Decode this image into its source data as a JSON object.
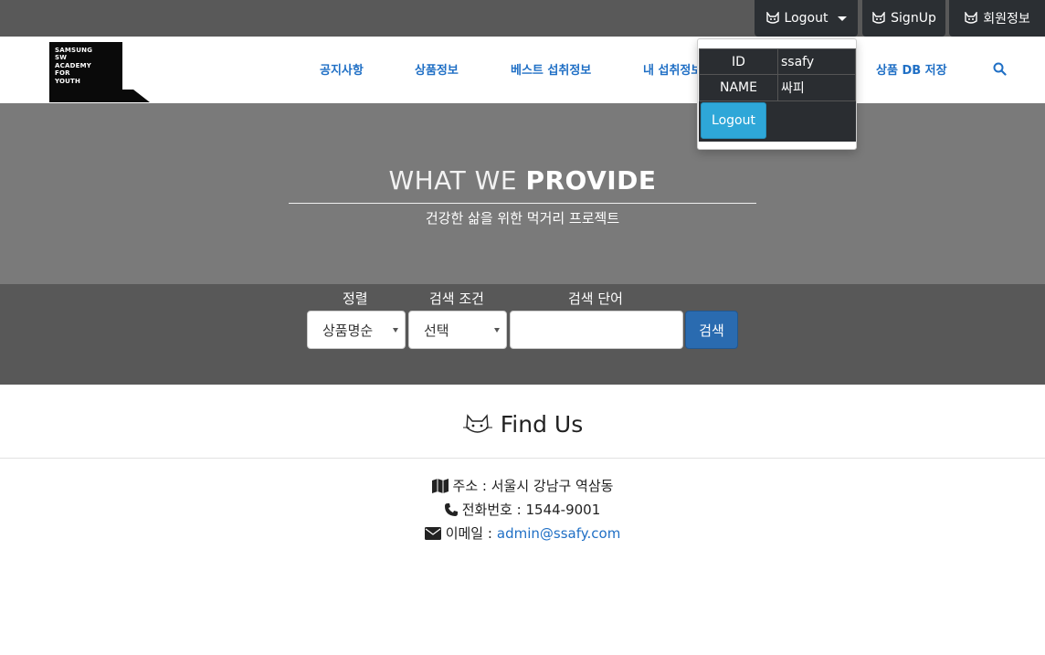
{
  "topbar": {
    "logout_label": "Logout",
    "signup_label": "SignUp",
    "member_label": "회원정보",
    "icon": "cat-icon"
  },
  "logo": {
    "lines": [
      "SAMSUNG",
      "SW",
      "ACADEMY",
      "FOR",
      "YOUTH"
    ]
  },
  "nav": {
    "items": [
      "공지사항",
      "상품정보",
      "베스트 섭취정보",
      "내 섭취정보",
      "상품 DB 저장"
    ],
    "search_icon": "search-icon"
  },
  "user_dropdown": {
    "id_label": "ID",
    "id_value": "ssafy",
    "name_label": "NAME",
    "name_value": "싸피",
    "logout_button": "Logout"
  },
  "hero": {
    "title_prefix": "WHAT WE",
    "title_bold": "PROVIDE",
    "subtitle": "건강한 삶을 위한 먹거리 프로젝트"
  },
  "search": {
    "sort_label": "정렬",
    "condition_label": "검색 조건",
    "keyword_label": "검색 단어",
    "sort_value": "상품명순",
    "condition_value": "선택",
    "keyword_value": "",
    "button_label": "검색"
  },
  "find_us": {
    "title": "Find Us",
    "address": "주소 : 서울시 강남구 역삼동",
    "phone": "전화번호 : 1544-9001",
    "email_label": "이메일 :",
    "email": "admin@ssafy.com"
  },
  "colors": {
    "topbar": "#595959",
    "hero": "#7a7a7a",
    "searchband": "#585858",
    "link": "#1f6fc5",
    "search_button": "#2a6bb0",
    "logout_button": "#2ea7d8"
  }
}
